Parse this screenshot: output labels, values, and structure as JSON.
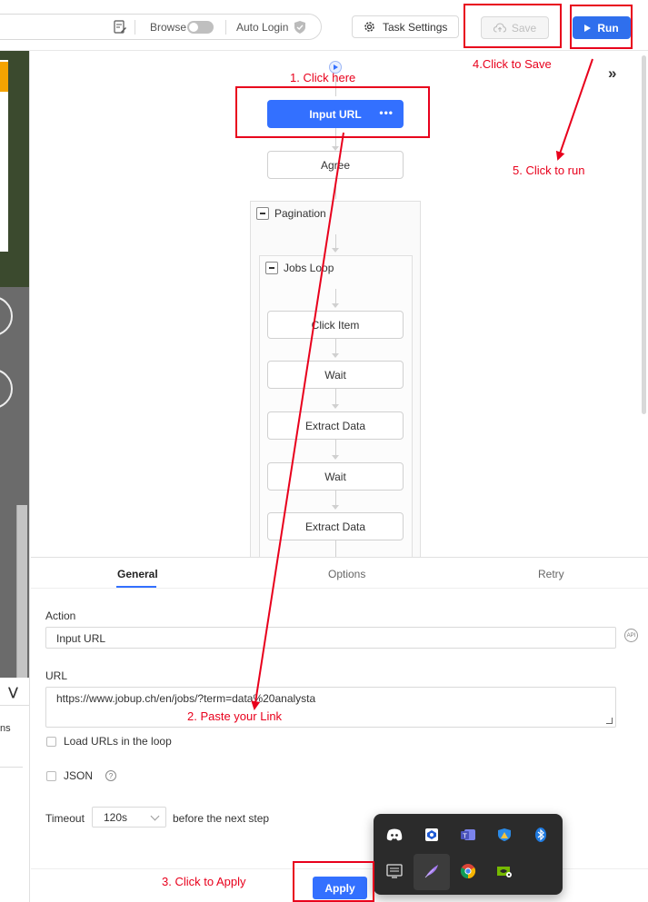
{
  "toolbar": {
    "browse_label": "Browse",
    "auto_login_label": "Auto Login",
    "task_settings_label": "Task Settings",
    "save_label": "Save",
    "run_label": "Run"
  },
  "workflow": {
    "nodes": {
      "input_url": "Input URL",
      "agree": "Agree",
      "pagination": "Pagination",
      "jobs_loop": "Jobs Loop",
      "click_item": "Click Item",
      "wait_1": "Wait",
      "extract_1": "Extract Data",
      "wait_2": "Wait",
      "extract_2": "Extract Data"
    }
  },
  "panel": {
    "tabs": [
      "General",
      "Options",
      "Retry"
    ],
    "active_tab": "General",
    "action_label": "Action",
    "action_value": "Input URL",
    "url_label": "URL",
    "url_value": "https://www.jobup.ch/en/jobs/?term=data%20analysta",
    "load_urls_label": "Load URLs in the loop",
    "json_label": "JSON",
    "timeout_label": "Timeout",
    "timeout_value": "120s",
    "timeout_suffix": "before the next step",
    "apply_label": "Apply",
    "api_badge": "API"
  },
  "left_strip": {
    "partial_text": "ns"
  },
  "annotations": {
    "step1": "1. Click here",
    "step2": "2. Paste your Link",
    "step3": "3. Click to Apply",
    "step4": "4.Click to Save",
    "step5": "5. Click to run",
    "color": "#e8001c"
  },
  "colors": {
    "accent": "#3370ff"
  }
}
